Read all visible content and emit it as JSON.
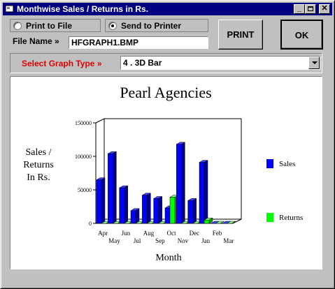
{
  "window": {
    "title": "Monthwise Sales / Returns in Rs."
  },
  "output_options": {
    "print_to_file": {
      "label": "Print to File",
      "selected": false
    },
    "send_to_printer": {
      "label": "Send to Printer",
      "selected": true
    }
  },
  "file_name": {
    "label": "File Name »",
    "value": "HFGRAPH1.BMP"
  },
  "buttons": {
    "print": "PRINT",
    "ok": "OK"
  },
  "graph_type": {
    "label": "Select Graph Type »",
    "selected": "4 . 3D Bar"
  },
  "chart_data": {
    "type": "bar",
    "title": "Pearl Agencies",
    "xlabel": "Month",
    "ylabel": [
      "Sales /",
      "Returns",
      "In Rs."
    ],
    "categories": [
      "Apr",
      "May",
      "Jun",
      "Jul",
      "Aug",
      "Sep",
      "Oct",
      "Nov",
      "Dec",
      "Jan",
      "Feb",
      "Mar"
    ],
    "ylim": [
      0,
      150000
    ],
    "yticks": [
      "0",
      "50000",
      "100000",
      "150000"
    ],
    "series": [
      {
        "name": "Sales",
        "color": "#0000ff",
        "values": [
          65000,
          104000,
          53000,
          19000,
          42000,
          37000,
          23000,
          118000,
          34000,
          91000,
          0,
          0
        ]
      },
      {
        "name": "Returns",
        "color": "#00ff00",
        "values": [
          0,
          0,
          0,
          0,
          0,
          0,
          39000,
          0,
          0,
          5000,
          0,
          0
        ]
      }
    ],
    "legend_position": "right"
  }
}
